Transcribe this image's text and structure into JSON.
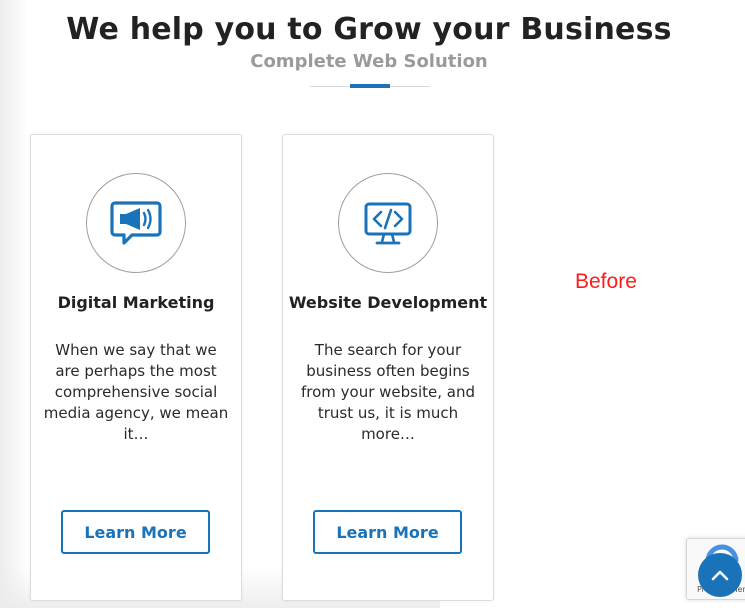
{
  "section": {
    "title": "We help you to Grow your Business",
    "subtitle": "Complete Web Solution"
  },
  "cards": [
    {
      "icon": "megaphone-icon",
      "title": "Digital Marketing",
      "text": "When we say that we are perhaps the most comprehensive social media agency, we mean it…",
      "button": "Learn More"
    },
    {
      "icon": "code-monitor-icon",
      "title": "Website Development",
      "text": "The search for your business often begins from your website, and trust us, it is much more…",
      "button": "Learn More"
    }
  ],
  "overlay": {
    "before_label": "Before"
  },
  "recaptcha": {
    "icon": "recaptcha-icon",
    "footer_text": "Privacy - Terms"
  },
  "scroll_top": {
    "icon": "chevron-up-icon"
  },
  "colors": {
    "accent": "#1a73b8",
    "before_label": "#ff1a1a",
    "heading": "#222222",
    "subheading": "#9a9a9a"
  }
}
